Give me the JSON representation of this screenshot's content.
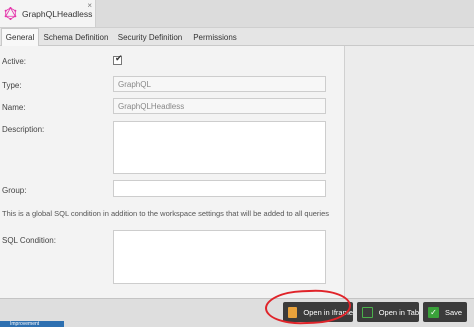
{
  "window": {
    "title": "GraphQLHeadless",
    "close_label": "×"
  },
  "tabs": [
    {
      "label": "General",
      "active": true
    },
    {
      "label": "Schema Definition",
      "active": false
    },
    {
      "label": "Security Definition",
      "active": false
    },
    {
      "label": "Permissions",
      "active": false
    }
  ],
  "form": {
    "active_label": "Active:",
    "active_checked": true,
    "type_label": "Type:",
    "type_value": "GraphQL",
    "name_label": "Name:",
    "name_value": "GraphQLHeadless",
    "description_label": "Description:",
    "description_value": "",
    "group_label": "Group:",
    "group_value": "",
    "sql_note": "This is a global SQL condition in addition to the workspace settings that will be added to all queries",
    "sql_label": "SQL Condition:",
    "sql_value": ""
  },
  "toolbar": {
    "open_iframe_label": "Open in Iframe",
    "open_tab_label": "Open in Tab",
    "save_label": "Save"
  },
  "taskbar": {
    "badge_label": "Improvement"
  },
  "colors": {
    "accent_highlight": "#e0242a",
    "button_bg": "#3b3b3b",
    "iframe_icon": "#e9a23b",
    "save_icon": "#3aa13a",
    "graphql_icon": "#e535ab"
  }
}
